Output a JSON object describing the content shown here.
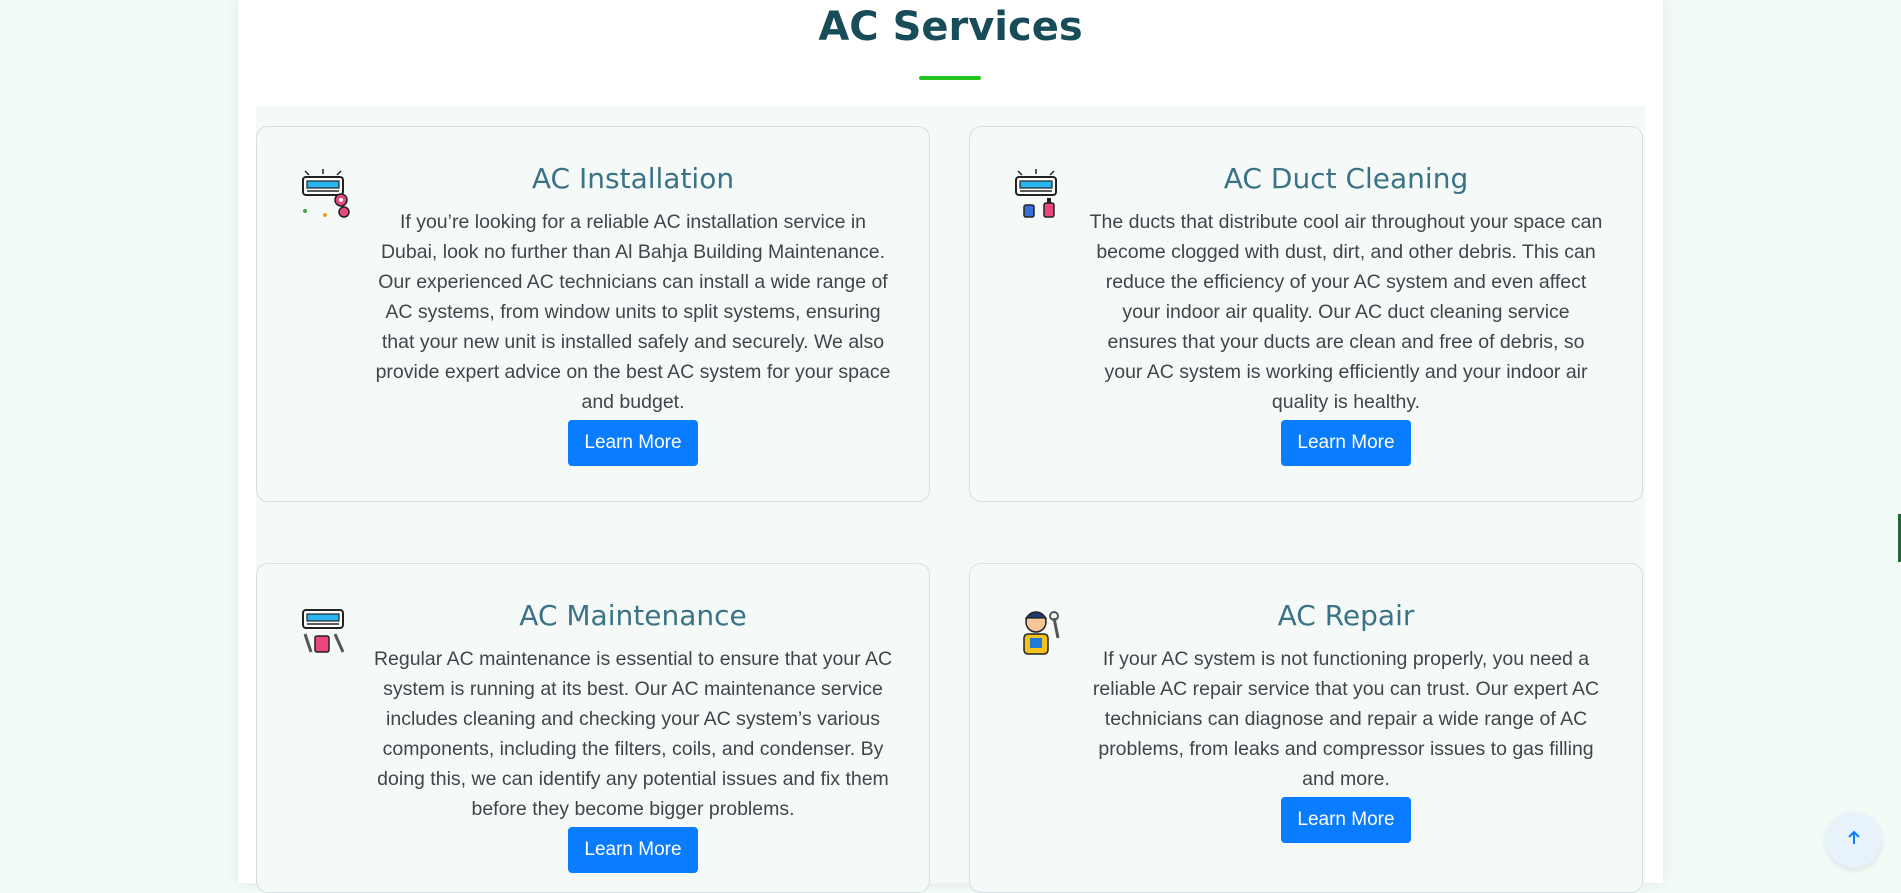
{
  "section": {
    "title": "AC Services"
  },
  "colors": {
    "accent": "#22c51e",
    "button": "#0a7cff",
    "title": "#174c58"
  },
  "cards": [
    {
      "title": "AC Installation",
      "text": "If you’re looking for a reliable AC installation service in Dubai, look no further than Al Bahja Building Maintenance. Our experienced AC technicians can install a wide range of AC systems, from window units to split systems, ensuring that your new unit is installed safely and securely. We also provide expert advice on the best AC system for your space and budget.",
      "button": "Learn More",
      "icon": "ac-installation-icon"
    },
    {
      "title": "AC Duct Cleaning",
      "text": "The ducts that distribute cool air throughout your space can become clogged with dust, dirt, and other debris. This can reduce the efficiency of your AC system and even affect your indoor air quality. Our AC duct cleaning service ensures that your ducts are clean and free of debris, so your AC system is working efficiently and your indoor air quality is healthy.",
      "button": "Learn More",
      "icon": "ac-cleaning-icon"
    },
    {
      "title": "AC Maintenance",
      "text": "Regular AC maintenance is essential to ensure that your AC system is running at its best. Our AC maintenance service includes cleaning and checking your AC system’s various components, including the filters, coils, and condenser. By doing this, we can identify any potential issues and fix them before they become bigger problems.",
      "button": "Learn More",
      "icon": "ac-maintenance-icon"
    },
    {
      "title": "AC Repair",
      "text": "If your AC system is not functioning properly, you need a reliable AC repair service that you can trust. Our expert AC technicians can diagnose and repair a wide range of AC problems, from leaks and compressor issues to gas filling and more.",
      "button": "Learn More",
      "icon": "technician-icon"
    }
  ],
  "scroll_top": {
    "icon": "arrow-up-icon"
  }
}
